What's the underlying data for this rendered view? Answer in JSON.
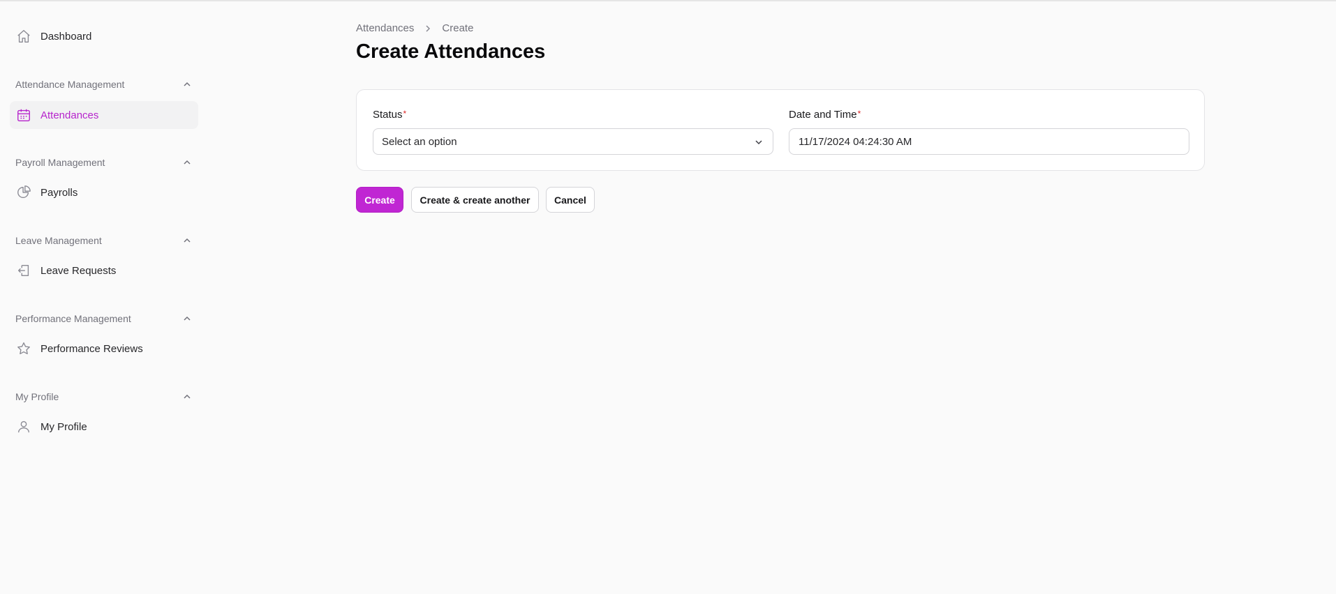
{
  "sidebar": {
    "dashboard": {
      "label": "Dashboard",
      "icon": "home-icon"
    },
    "groups": [
      {
        "label": "Attendance Management",
        "item": {
          "label": "Attendances",
          "icon": "calendar-icon",
          "active": true
        }
      },
      {
        "label": "Payroll Management",
        "item": {
          "label": "Payrolls",
          "icon": "pie-chart-icon"
        }
      },
      {
        "label": "Leave Management",
        "item": {
          "label": "Leave Requests",
          "icon": "logout-icon"
        }
      },
      {
        "label": "Performance Management",
        "item": {
          "label": "Performance Reviews",
          "icon": "star-icon"
        }
      },
      {
        "label": "My Profile",
        "item": {
          "label": "My Profile",
          "icon": "user-icon"
        }
      }
    ]
  },
  "breadcrumb": {
    "parent": "Attendances",
    "current": "Create"
  },
  "page": {
    "title": "Create Attendances"
  },
  "form": {
    "status": {
      "label": "Status",
      "required_mark": "*",
      "value": "Select an option"
    },
    "datetime": {
      "label": "Date and Time",
      "required_mark": "*",
      "value": "11/17/2024 04:24:30 AM"
    }
  },
  "actions": {
    "create": "Create",
    "create_another": "Create & create another",
    "cancel": "Cancel"
  },
  "colors": {
    "accent": "#c026d3",
    "active_text": "#b624cc",
    "required": "#dc2626"
  }
}
